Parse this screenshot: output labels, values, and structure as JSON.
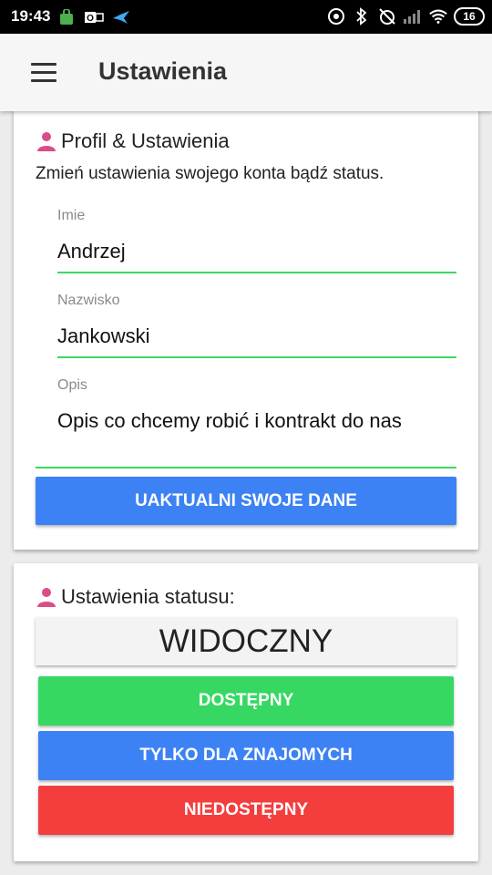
{
  "statusbar": {
    "time": "19:43",
    "battery": "16"
  },
  "appbar": {
    "title": "Ustawienia"
  },
  "profile_card": {
    "title": "Profil & Ustawienia",
    "subtitle": "Zmień ustawienia swojego konta bądź status.",
    "fields": [
      {
        "label": "Imie",
        "value": "Andrzej"
      },
      {
        "label": "Nazwisko",
        "value": "Jankowski"
      },
      {
        "label": "Opis",
        "value": "Opis co chcemy robić i kontrakt do nas"
      }
    ],
    "update_button": "UAKTUALNI SWOJE DANE"
  },
  "status_card": {
    "title": "Ustawienia statusu:",
    "current_status": "WIDOCZNY",
    "buttons": {
      "available": "DOSTĘPNY",
      "friends_only": "TYLKO DLA ZNAJOMYCH",
      "unavailable": "NIEDOSTĘPNY"
    }
  },
  "colors": {
    "accent_icon": "#d94d8a",
    "field_underline": "#3ed860",
    "primary_blue": "#3d82f4",
    "green": "#36d862",
    "red": "#f43e3e"
  }
}
